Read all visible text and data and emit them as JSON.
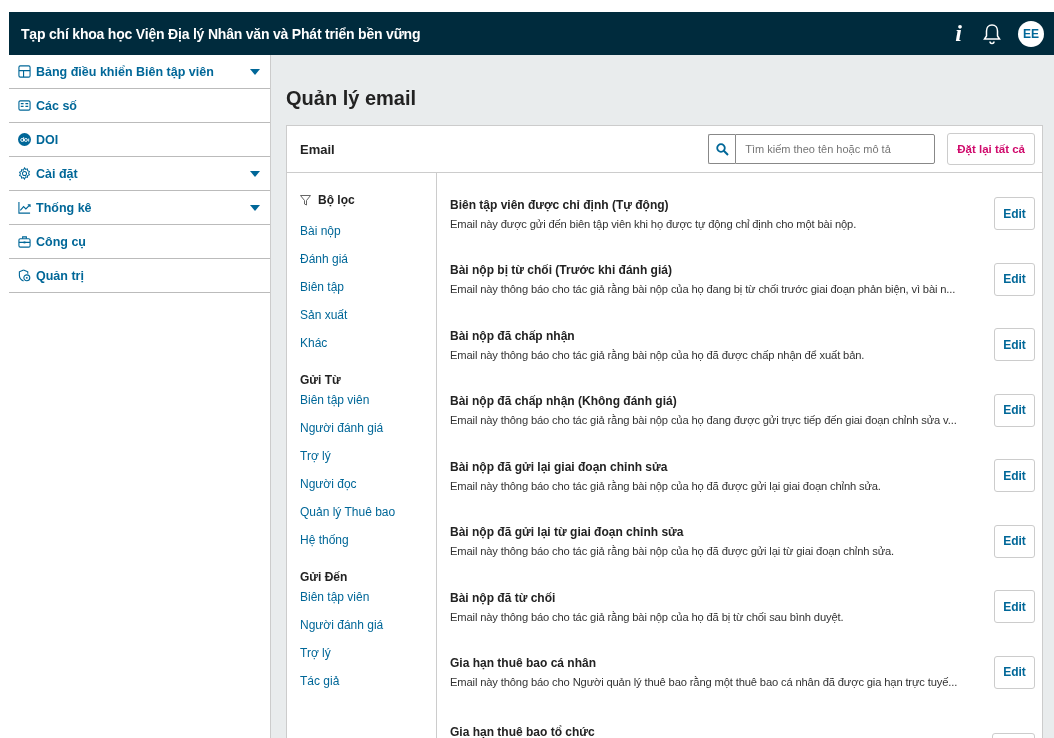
{
  "header": {
    "title": "Tạp chí khoa học Viện Địa lý Nhân văn và Phát triển bền vững",
    "info": "i",
    "avatar": "EE"
  },
  "sidebar": {
    "items": [
      {
        "label": "Bảng điều khiển Biên tập viên",
        "expandable": true
      },
      {
        "label": "Các số",
        "expandable": false
      },
      {
        "label": "DOI",
        "expandable": false
      },
      {
        "label": "Cài đặt",
        "expandable": true
      },
      {
        "label": "Thống kê",
        "expandable": true
      },
      {
        "label": "Công cụ",
        "expandable": false
      },
      {
        "label": "Quản trị",
        "expandable": false
      }
    ]
  },
  "page_title": "Quản lý email",
  "panel": {
    "title": "Email",
    "search": {
      "placeholder": "Tìm kiếm theo tên hoặc mô tả"
    },
    "reset_button": "Đặt lại tất cả",
    "filters": [
      {
        "kind": "filter",
        "heading": "Bộ lọc",
        "items": [
          "Bài nộp",
          "Đánh giá",
          "Biên tập",
          "Sản xuất",
          "Khác"
        ]
      },
      {
        "kind": "group",
        "heading": "Gửi Từ",
        "items": [
          "Biên tập viên",
          "Người đánh giá",
          "Trợ lý",
          "Người đọc",
          "Quản lý Thuê bao",
          "Hệ thống"
        ]
      },
      {
        "kind": "group",
        "heading": "Gửi Đến",
        "items": [
          "Biên tập viên",
          "Người đánh giá",
          "Trợ lý",
          "Tác giả"
        ]
      }
    ],
    "emails": [
      {
        "title": "Biên tập viên được chỉ định (Tự động)",
        "description": "Email này được gửi đến biên tập viên khi họ được tự động chỉ định cho một bài nộp.",
        "button": "Edit"
      },
      {
        "title": "Bài nộp bị từ chối (Trước khi đánh giá)",
        "description": "Email này thông báo cho tác giả rằng bài nộp của họ đang bị từ chối trước giai đoạn phản biện, vì bài n...",
        "button": "Edit"
      },
      {
        "title": "Bài nộp đã chấp nhận",
        "description": "Email này thông báo cho tác giả rằng bài nộp của họ đã được chấp nhận để xuất bản.",
        "button": "Edit"
      },
      {
        "title": "Bài nộp đã chấp nhận (Không đánh giá)",
        "description": "Email này thông báo cho tác giả rằng bài nộp của họ đang được gửi trực tiếp đến giai đoạn chỉnh sửa v...",
        "button": "Edit"
      },
      {
        "title": "Bài nộp đã gửi lại giai đoạn chỉnh sửa",
        "description": "Email này thông báo cho tác giả rằng bài nộp của họ đã được gửi lại giai đoạn chỉnh sửa.",
        "button": "Edit"
      },
      {
        "title": "Bài nộp đã gửi lại từ giai đoạn chỉnh sửa",
        "description": "Email này thông báo cho tác giả rằng bài nộp của họ đã được gửi lại từ giai đoạn chỉnh sửa.",
        "button": "Edit"
      },
      {
        "title": "Bài nộp đã từ chối",
        "description": "Email này thông báo cho tác giả rằng bài nộp của họ đã bị từ chối sau bình duyệt.",
        "button": "Edit"
      },
      {
        "title": "Gia hạn thuê bao cá nhân",
        "description": "Email này thông báo cho Người quản lý thuê bao rằng một thuê bao cá nhân đã được gia hạn trực tuyế...",
        "button": "Edit"
      },
      {
        "title": "Gia hạn thuê bao tổ chức"
      }
    ]
  }
}
